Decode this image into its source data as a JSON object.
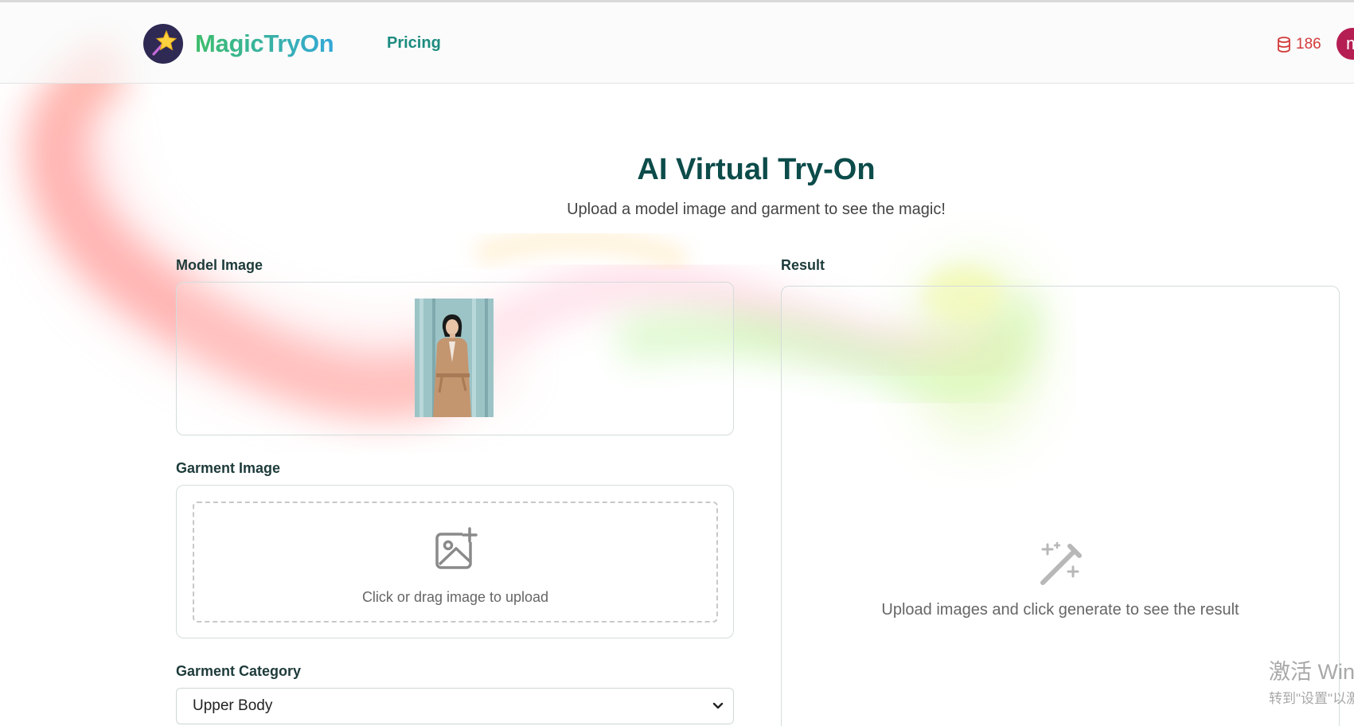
{
  "header": {
    "brand": "MagicTryOn",
    "nav_pricing": "Pricing",
    "credits": "186",
    "avatar_initial": "m"
  },
  "hero": {
    "title": "AI Virtual Try-On",
    "subtitle": "Upload a model image and garment to see the magic!"
  },
  "model_section": {
    "label": "Model Image"
  },
  "garment_section": {
    "label": "Garment Image",
    "upload_text": "Click or drag image to upload"
  },
  "category_section": {
    "label": "Garment Category",
    "selected": "Upper Body"
  },
  "result_section": {
    "label": "Result",
    "placeholder": "Upload images and click generate to see the result"
  },
  "watermark": {
    "line1": "激活 Wind",
    "line2": "转到\"设置\"以激"
  },
  "colors": {
    "brand_start": "#3dbd6a",
    "brand_end": "#34a8d8",
    "title": "#0c4c4a",
    "pricing": "#1c8b7f",
    "credits": "#d43b3b",
    "avatar": "#b51e52"
  },
  "icons": {
    "logo": "magic-wand-star-icon",
    "credits": "database-coins-icon",
    "upload": "image-plus-icon",
    "select": "chevron-down-icon",
    "result": "magic-wand-sparkles-icon"
  }
}
